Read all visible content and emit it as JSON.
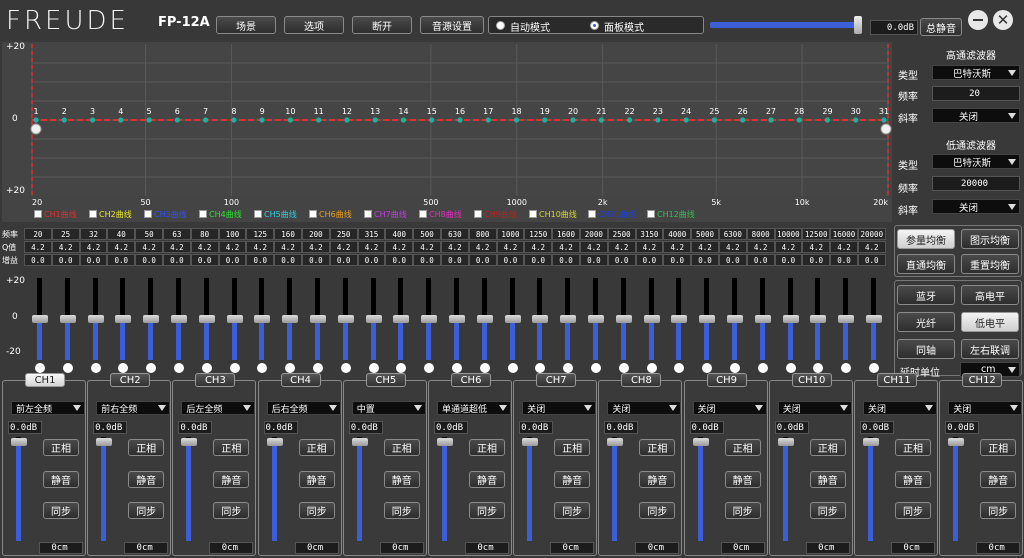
{
  "header": {
    "logo": "FREUDE",
    "model": "FP-12A",
    "buttons": [
      "场景",
      "选项",
      "断开",
      "音源设置"
    ],
    "mode_auto": "自动模式",
    "mode_panel": "面板模式",
    "master_gain": "0.0dB",
    "master_mute": "总静音",
    "master_level_pct": 100
  },
  "graph": {
    "y_top": "+20",
    "y_mid": "0",
    "y_bot": "+20",
    "x_ticks": [
      "20",
      "50",
      "100",
      "500",
      "1000",
      "2k",
      "5k",
      "10k",
      "20k"
    ],
    "band_numbers": [
      "1",
      "2",
      "3",
      "4",
      "5",
      "6",
      "7",
      "8",
      "9",
      "10",
      "11",
      "12",
      "13",
      "14",
      "15",
      "16",
      "17",
      "18",
      "19",
      "20",
      "21",
      "22",
      "23",
      "24",
      "25",
      "26",
      "27",
      "28",
      "29",
      "30",
      "31"
    ],
    "curves": [
      {
        "label": "CH1曲线",
        "color": "#e03030"
      },
      {
        "label": "CH2曲线",
        "color": "#e8e830"
      },
      {
        "label": "CH3曲线",
        "color": "#3050ff"
      },
      {
        "label": "CH4曲线",
        "color": "#30e030"
      },
      {
        "label": "CH5曲线",
        "color": "#30d0e0"
      },
      {
        "label": "CH6曲线",
        "color": "#e8a020"
      },
      {
        "label": "CH7曲线",
        "color": "#c040e0"
      },
      {
        "label": "CH8曲线",
        "color": "#e030c0"
      },
      {
        "label": "CH9曲线",
        "color": "#c02020"
      },
      {
        "label": "CH10曲线",
        "color": "#d8d830"
      },
      {
        "label": "CH11曲线",
        "color": "#2040d0"
      },
      {
        "label": "CH12曲线",
        "color": "#30c050"
      }
    ]
  },
  "hpf": {
    "title": "高通滤波器",
    "type_label": "类型",
    "type_value": "巴特沃斯",
    "freq_label": "频率",
    "freq_value": "20",
    "slope_label": "斜率",
    "slope_value": "关闭"
  },
  "lpf": {
    "title": "低通滤波器",
    "type_label": "类型",
    "type_value": "巴特沃斯",
    "freq_label": "频率",
    "freq_value": "20000",
    "slope_label": "斜率",
    "slope_value": "关闭"
  },
  "eq": {
    "row_labels": [
      "频率",
      "Q值",
      "增益"
    ],
    "freqs": [
      "20",
      "25",
      "32",
      "40",
      "50",
      "63",
      "80",
      "100",
      "125",
      "160",
      "200",
      "250",
      "315",
      "400",
      "500",
      "630",
      "800",
      "1000",
      "1250",
      "1600",
      "2000",
      "2500",
      "3150",
      "4000",
      "5000",
      "6300",
      "8000",
      "10000",
      "12500",
      "16000",
      "20000"
    ],
    "q": "4.2",
    "gain": "0.0",
    "gain_values": [
      0,
      0,
      0,
      0,
      0,
      0,
      0,
      0,
      0,
      0,
      0,
      0,
      0,
      0,
      0,
      0,
      0,
      0,
      0,
      0,
      0,
      0,
      0,
      0,
      0,
      0,
      0,
      0,
      0,
      0,
      0
    ],
    "scale_top": "+20",
    "scale_mid": "0",
    "scale_bot": "-20"
  },
  "right_buttons": {
    "param_eq": "参量均衡",
    "graphic_eq": "图示均衡",
    "bypass_eq": "直通均衡",
    "reset_eq": "重置均衡",
    "bluetooth": "蓝牙",
    "high_level": "高电平",
    "optical": "光纤",
    "low_level": "低电平",
    "coax": "同轴",
    "lr_link": "左右联调",
    "delay_unit_label": "延时单位",
    "delay_unit_value": "cm"
  },
  "channels": [
    {
      "name": "CH1",
      "assign": "前左全频",
      "gain": "0.0dB",
      "level_pct": 95,
      "phase": "正相",
      "mute": "静音",
      "sync": "同步",
      "delay": "0cm"
    },
    {
      "name": "CH2",
      "assign": "前右全频",
      "gain": "0.0dB",
      "level_pct": 95,
      "phase": "正相",
      "mute": "静音",
      "sync": "同步",
      "delay": "0cm"
    },
    {
      "name": "CH3",
      "assign": "后左全频",
      "gain": "0.0dB",
      "level_pct": 95,
      "phase": "正相",
      "mute": "静音",
      "sync": "同步",
      "delay": "0cm"
    },
    {
      "name": "CH4",
      "assign": "后右全频",
      "gain": "0.0dB",
      "level_pct": 95,
      "phase": "正相",
      "mute": "静音",
      "sync": "同步",
      "delay": "0cm"
    },
    {
      "name": "CH5",
      "assign": "中置",
      "gain": "0.0dB",
      "level_pct": 95,
      "phase": "正相",
      "mute": "静音",
      "sync": "同步",
      "delay": "0cm"
    },
    {
      "name": "CH6",
      "assign": "单通道超低",
      "gain": "0.0dB",
      "level_pct": 95,
      "phase": "正相",
      "mute": "静音",
      "sync": "同步",
      "delay": "0cm"
    },
    {
      "name": "CH7",
      "assign": "关闭",
      "gain": "0.0dB",
      "level_pct": 95,
      "phase": "正相",
      "mute": "静音",
      "sync": "同步",
      "delay": "0cm"
    },
    {
      "name": "CH8",
      "assign": "关闭",
      "gain": "0.0dB",
      "level_pct": 95,
      "phase": "正相",
      "mute": "静音",
      "sync": "同步",
      "delay": "0cm"
    },
    {
      "name": "CH9",
      "assign": "关闭",
      "gain": "0.0dB",
      "level_pct": 95,
      "phase": "正相",
      "mute": "静音",
      "sync": "同步",
      "delay": "0cm"
    },
    {
      "name": "CH10",
      "assign": "关闭",
      "gain": "0.0dB",
      "level_pct": 95,
      "phase": "正相",
      "mute": "静音",
      "sync": "同步",
      "delay": "0cm"
    },
    {
      "name": "CH11",
      "assign": "关闭",
      "gain": "0.0dB",
      "level_pct": 95,
      "phase": "正相",
      "mute": "静音",
      "sync": "同步",
      "delay": "0cm"
    },
    {
      "name": "CH12",
      "assign": "关闭",
      "gain": "0.0dB",
      "level_pct": 95,
      "phase": "正相",
      "mute": "静音",
      "sync": "同步",
      "delay": "0cm"
    }
  ],
  "colors": {
    "accent": "#3c5fd8",
    "curve": "#e03030",
    "node": "#20b0a0",
    "hpf_line": "#c03030"
  }
}
